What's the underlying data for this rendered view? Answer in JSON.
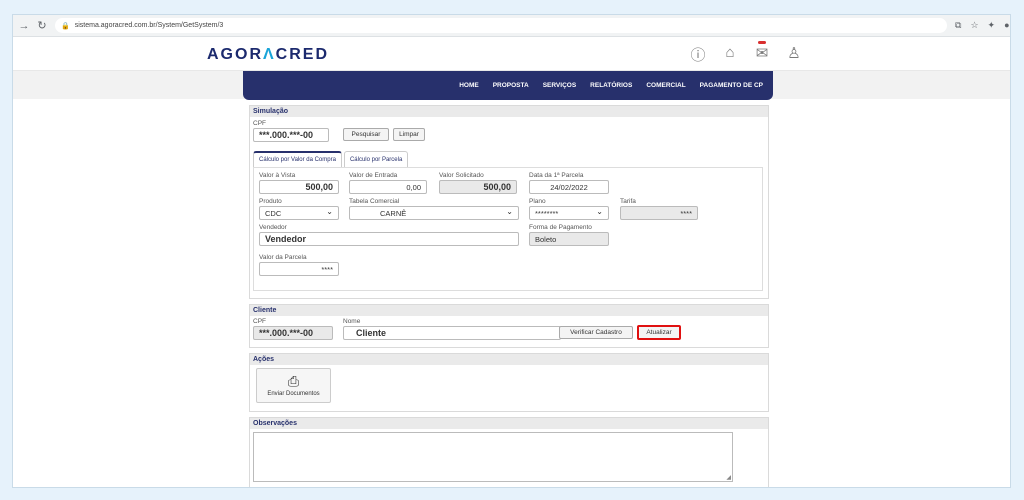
{
  "browser": {
    "url": "sistema.agoracred.com.br/System/GetSystem/3",
    "back_icon": "arrow-right-icon",
    "reload_icon": "reload-icon"
  },
  "header": {
    "logo_left": "AGOR",
    "logo_a": "Λ",
    "logo_right": "CRED",
    "icons": [
      "help-icon",
      "home-icon",
      "mail-icon",
      "user-icon"
    ]
  },
  "nav": {
    "items": [
      "HOME",
      "PROPOSTA",
      "SERVIÇOS",
      "RELATÓRIOS",
      "COMERCIAL",
      "PAGAMENTO DE CP"
    ]
  },
  "simulacao": {
    "title": "Simulação",
    "cpf_label": "CPF",
    "cpf_value": "***.000.***-00",
    "pesquisar": "Pesquisar",
    "limpar": "Limpar",
    "tabs": [
      "Cálculo por Valor da Compra",
      "Cálculo por Parcela"
    ],
    "valor_vista_label": "Valor à Vista",
    "valor_vista": "500,00",
    "valor_entrada_label": "Valor de Entrada",
    "valor_entrada": "0,00",
    "valor_solicitado_label": "Valor Solicitado",
    "valor_solicitado": "500,00",
    "data_parcela_label": "Data da 1ª Parcela",
    "data_parcela": "24/02/2022",
    "produto_label": "Produto",
    "produto": "CDC",
    "tabela_label": "Tabela Comercial",
    "tabela": "CARNÊ",
    "plano_label": "Plano",
    "plano": "********",
    "tarifa_label": "Tarifa",
    "tarifa": "****",
    "vendedor_label": "Vendedor",
    "vendedor": "Vendedor",
    "forma_label": "Forma de Pagamento",
    "forma": "Boleto",
    "parcela_label": "Valor da Parcela",
    "parcela": "****"
  },
  "cliente": {
    "title": "Cliente",
    "cpf_label": "CPF",
    "cpf_value": "***.000.***-00",
    "nome_label": "Nome",
    "nome": "Cliente",
    "verificar": "Verificar Cadastro",
    "atualizar": "Atualizar"
  },
  "acoes": {
    "title": "Ações",
    "enviar": "Enviar Documentos"
  },
  "observacoes": {
    "title": "Observações"
  },
  "colors": {
    "nav_bg": "#27306c",
    "logo_accent": "#19a4d8",
    "highlight": "#e01010"
  }
}
